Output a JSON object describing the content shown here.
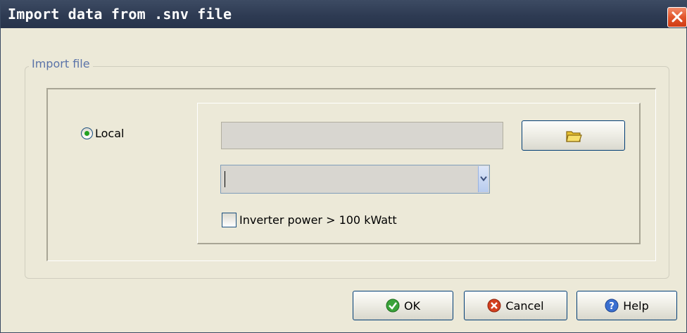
{
  "window": {
    "title": "Import data from .snv file"
  },
  "group": {
    "label": "Import file"
  },
  "local": {
    "label": "Local",
    "selected": true
  },
  "path_field": {
    "value": ""
  },
  "combo": {
    "value": ""
  },
  "inverter": {
    "label": "Inverter power > 100 kWatt",
    "checked": false
  },
  "buttons": {
    "ok": "OK",
    "cancel": "Cancel",
    "help": "Help"
  },
  "icons": {
    "close": "close-icon",
    "folder": "folder-icon",
    "dropdown": "chevron-down-icon",
    "ok": "check-icon",
    "cancel": "cancel-icon",
    "help": "help-icon"
  },
  "colors": {
    "titlebar": "#2e3b53",
    "dialog_bg": "#ECE9D8",
    "group_label": "#5a73a8",
    "ok_icon": "#3aa33a",
    "cancel_icon": "#d3401f",
    "help_icon": "#3a6fd0"
  }
}
